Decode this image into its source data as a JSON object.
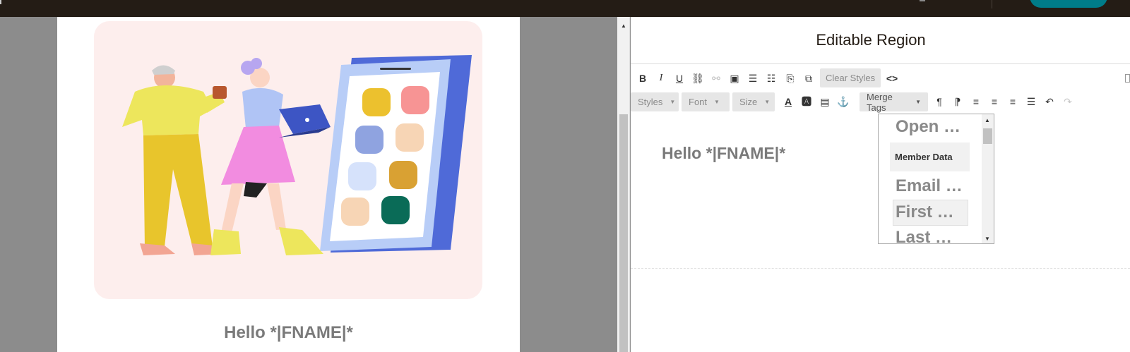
{
  "editor": {
    "title": "Editable Region",
    "greeting": "Hello *|FNAME|*"
  },
  "preview": {
    "greeting": "Hello *|FNAME|*"
  },
  "toolbar": {
    "row1_icons": [
      "bold-icon",
      "italic-icon",
      "underline-icon",
      "link-icon",
      "unlink-icon",
      "image-icon",
      "ordered-list-icon",
      "unordered-list-icon",
      "paste-icon",
      "paste-text-icon"
    ],
    "clear_styles": "Clear Styles",
    "source_icon": "source-code-icon",
    "styles": "Styles",
    "font": "Font",
    "size": "Size",
    "merge_tags": "Merge Tags",
    "row2_icons": [
      "text-color-icon",
      "background-color-icon",
      "block-icon",
      "anchor-icon",
      "paragraph-ltr-icon",
      "paragraph-rtl-icon",
      "align-left-icon",
      "align-center-icon",
      "align-right-icon",
      "align-justify-icon",
      "undo-icon",
      "redo-icon"
    ]
  },
  "merge_menu": {
    "items": [
      "Open …",
      "Email …",
      "First …",
      "Last …"
    ],
    "group_label": "Member Data"
  },
  "colors": {
    "topbar": "#241c15",
    "accent": "#007c89",
    "hero_background": "#fdeeed"
  }
}
